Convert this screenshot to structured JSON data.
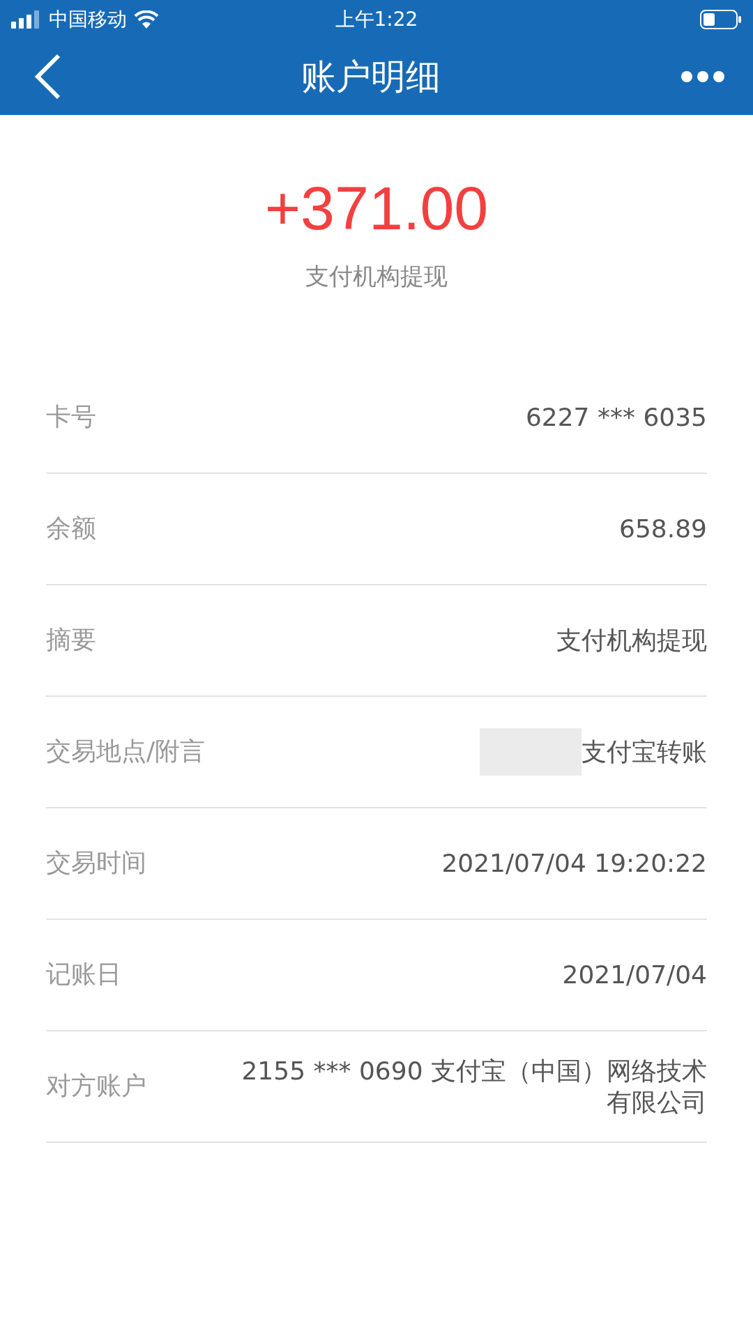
{
  "status_bar": {
    "carrier": "中国移动",
    "time": "上午1:22"
  },
  "header": {
    "title": "账户明细"
  },
  "summary": {
    "amount": "+371.00",
    "description": "支付机构提现"
  },
  "rows": [
    {
      "label": "卡号",
      "value": "6227 *** 6035",
      "redacted": false
    },
    {
      "label": "余额",
      "value": "658.89",
      "redacted": false
    },
    {
      "label": "摘要",
      "value": "支付机构提现",
      "redacted": false
    },
    {
      "label": "交易地点/附言",
      "value": "支付宝转账",
      "redacted": true
    },
    {
      "label": "交易时间",
      "value": "2021/07/04 19:20:22",
      "redacted": false
    },
    {
      "label": "记账日",
      "value": "2021/07/04",
      "redacted": false
    },
    {
      "label": "对方账户",
      "value": "2155 *** 0690 支付宝（中国）网络技术有限公司",
      "redacted": false
    }
  ]
}
